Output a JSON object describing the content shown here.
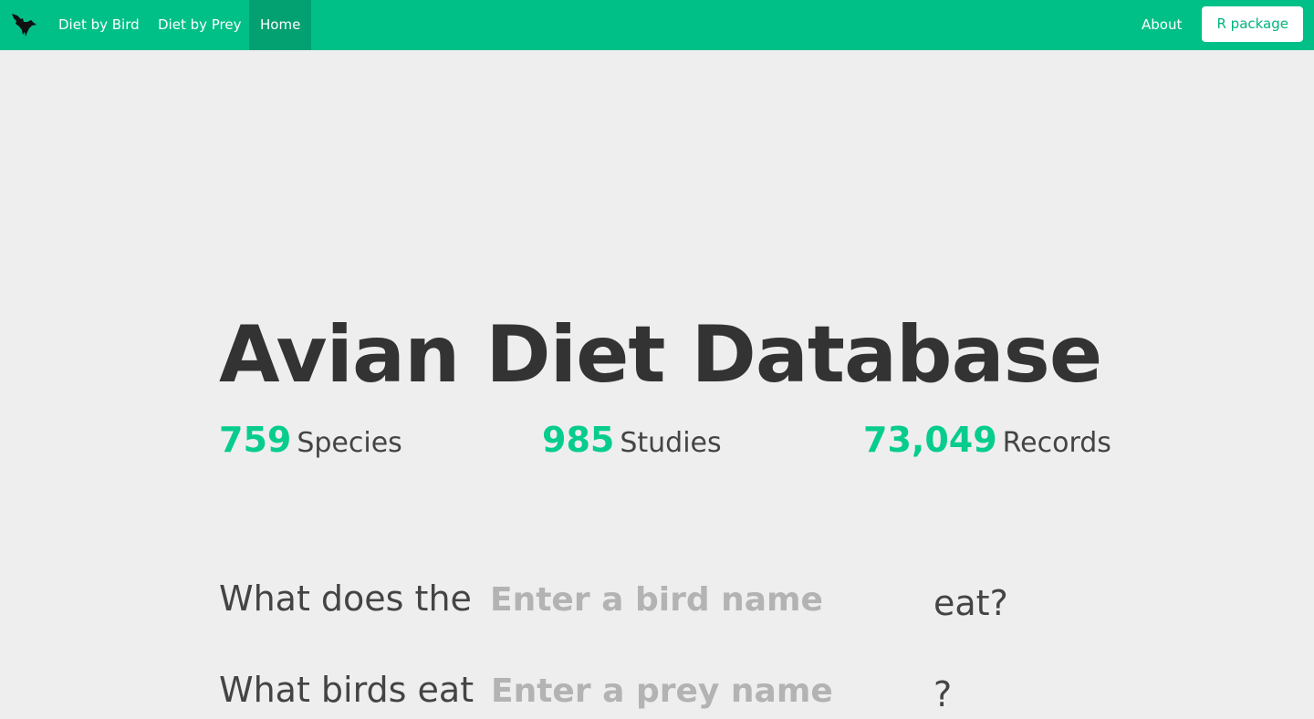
{
  "nav": {
    "logo_icon": "bird-silhouette-icon",
    "links": [
      {
        "label": "Diet by Bird"
      },
      {
        "label": "Diet by Prey"
      },
      {
        "label": "Home",
        "active": true
      }
    ],
    "about_label": "About",
    "r_package_label": "R package",
    "accent_color": "#00c087"
  },
  "hero": {
    "title": "Avian Diet Database",
    "stats": [
      {
        "value": "759",
        "label": "Species"
      },
      {
        "value": "985",
        "label": "Studies"
      },
      {
        "value": "73,049",
        "label": "Records"
      }
    ]
  },
  "queries": {
    "bird": {
      "prefix": "What does the",
      "placeholder": "Enter a bird name",
      "value": "",
      "suffix": "eat?"
    },
    "prey": {
      "prefix": "What birds eat",
      "placeholder": "Enter a prey name",
      "value": "",
      "suffix": "?"
    }
  }
}
